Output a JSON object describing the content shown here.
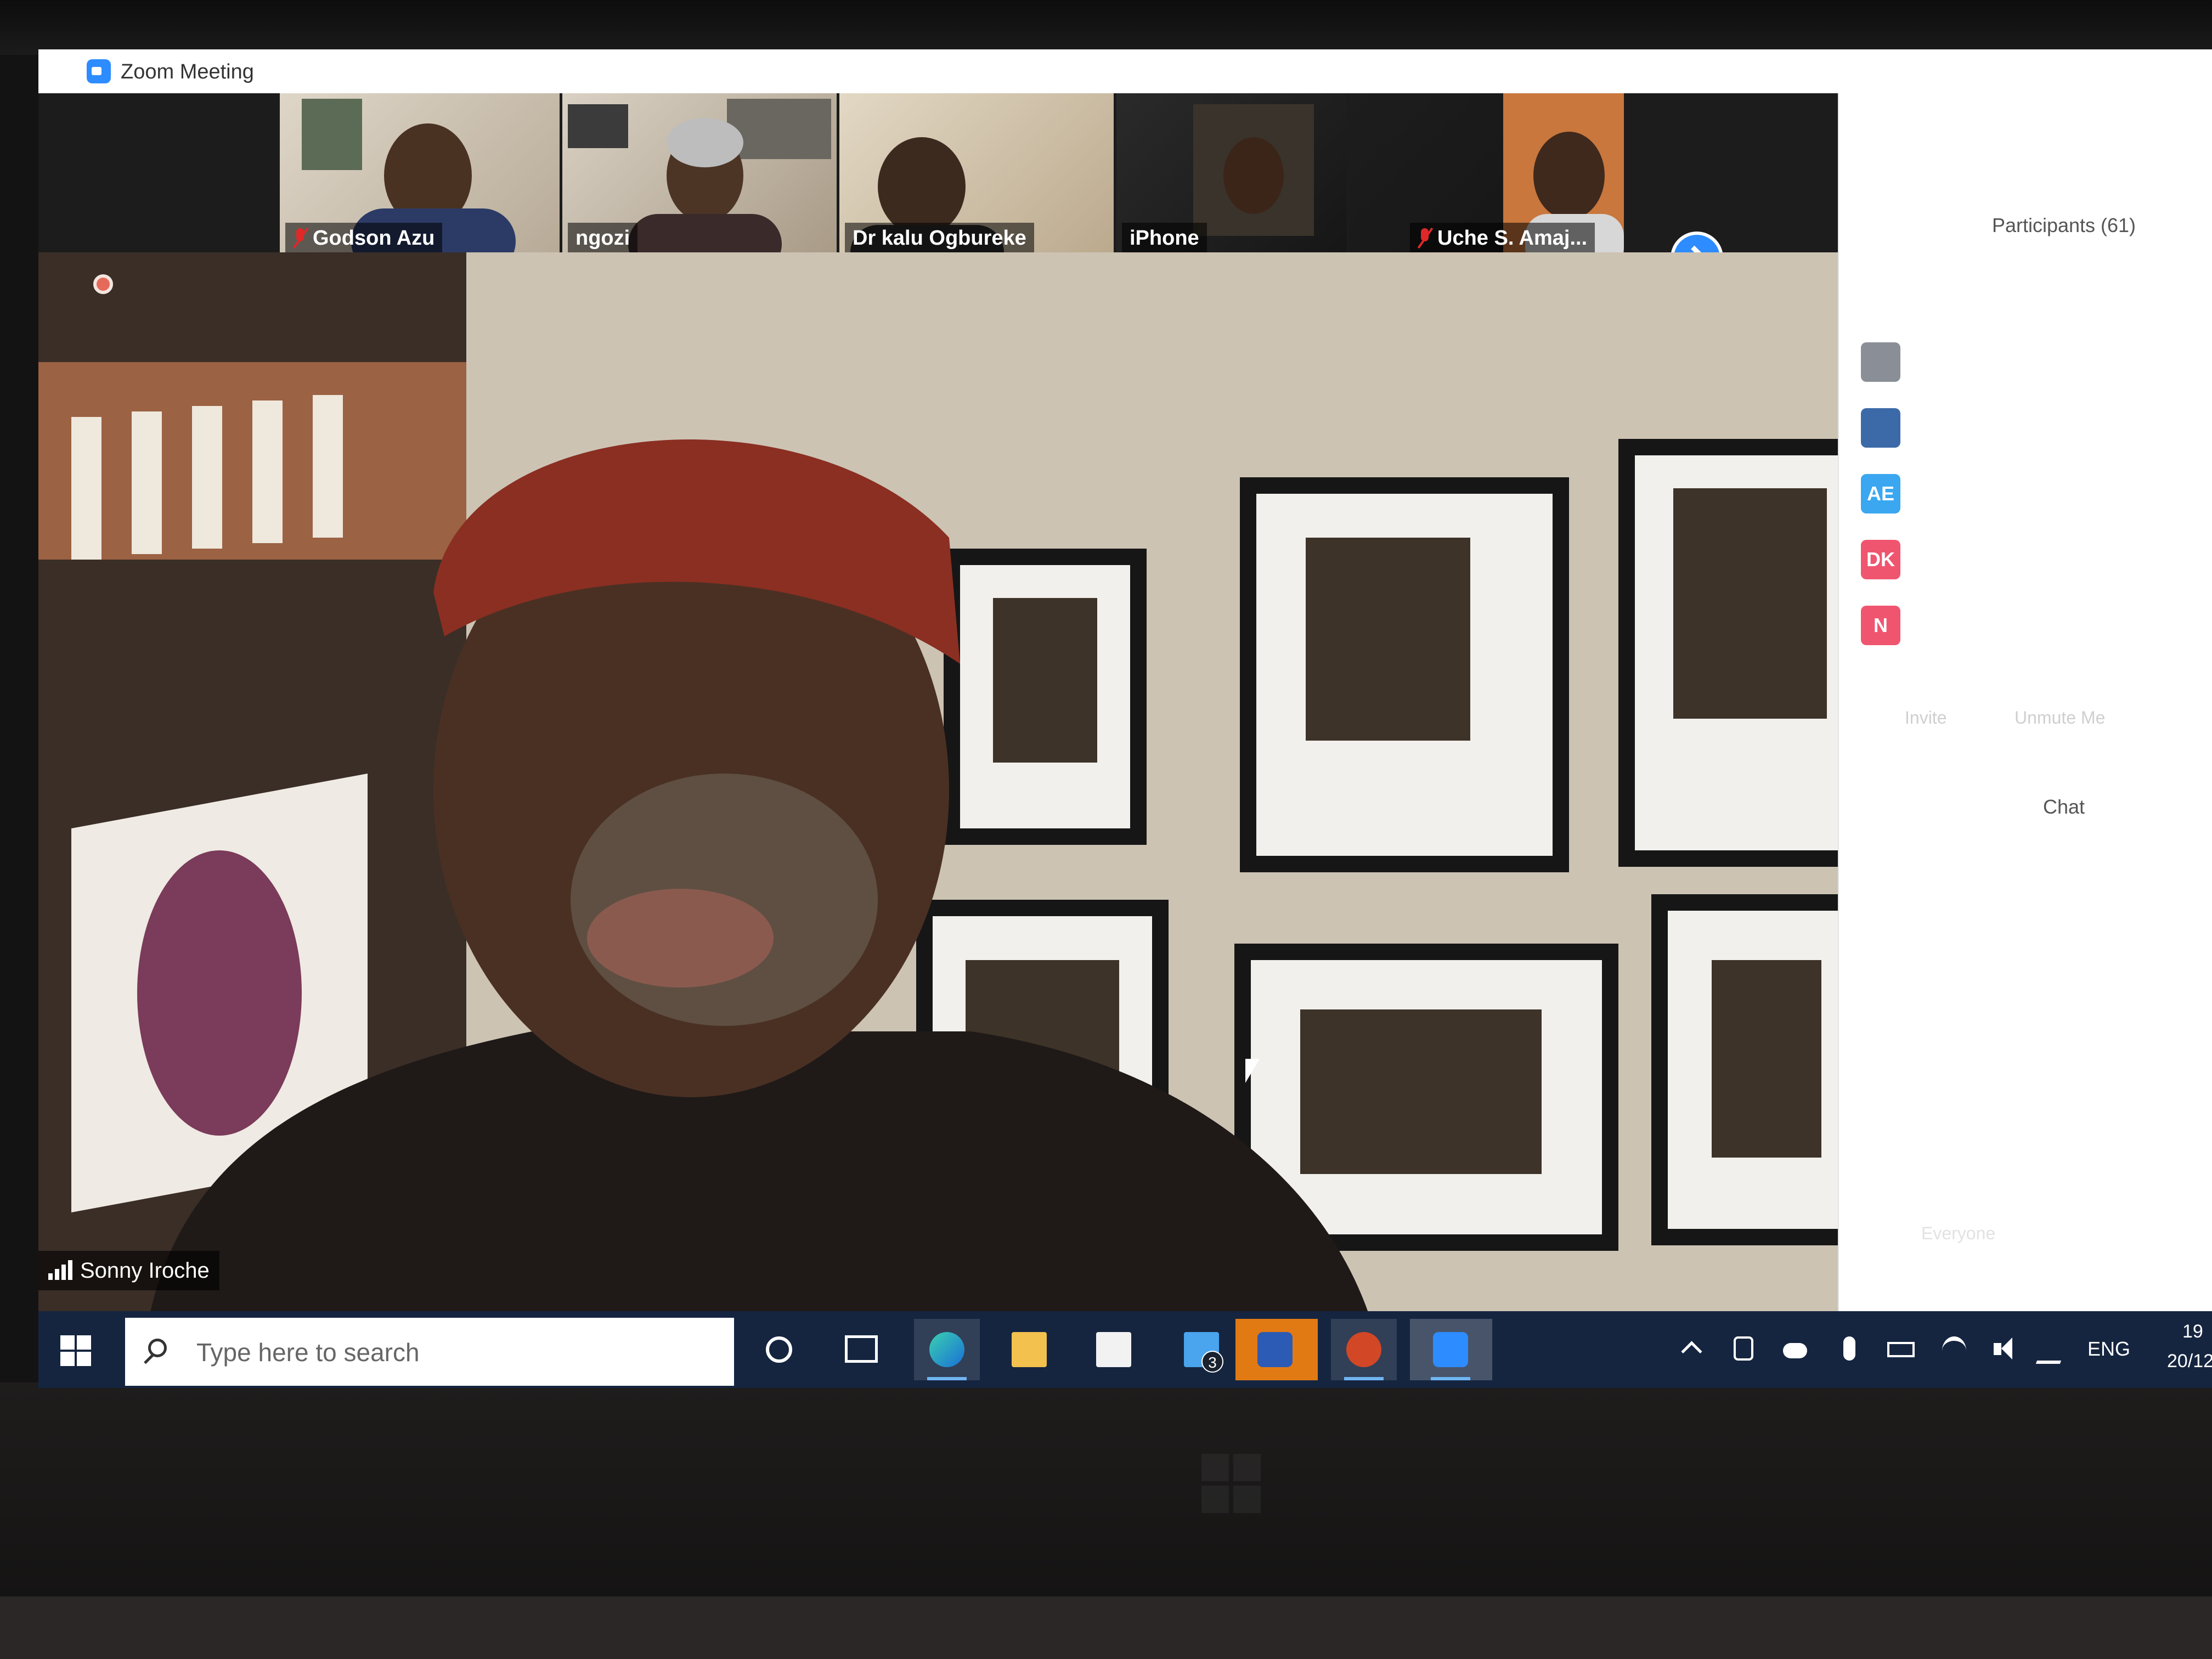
{
  "window": {
    "title": "Zoom Meeting"
  },
  "gallery": {
    "thumbnails": [
      {
        "name": "Godson Azu",
        "muted": true
      },
      {
        "name": "ngozi",
        "muted": false
      },
      {
        "name": "Dr kalu Ogbureke",
        "muted": false
      },
      {
        "name": "iPhone",
        "muted": false
      },
      {
        "name": "Uche S. Amaj...",
        "muted": true
      }
    ]
  },
  "main_video": {
    "speaker_name": "Sonny Iroche"
  },
  "participants_panel": {
    "title": "Participants (61)",
    "entries": [
      {
        "initials": "",
        "color": "#8a8f97"
      },
      {
        "initials": "",
        "color": "#3c6aa8"
      },
      {
        "initials": "AE",
        "color": "#3aa7f0"
      },
      {
        "initials": "DK",
        "color": "#f0556f"
      },
      {
        "initials": "N",
        "color": "#f0556f"
      }
    ],
    "invite_label": "Invite",
    "unmute_label": "Unmute Me"
  },
  "chat_panel": {
    "title": "Chat",
    "to_label": "Everyone"
  },
  "taskbar": {
    "search_placeholder": "Type here to search",
    "mail_badge": "3",
    "language": "ENG",
    "clock_time": "19",
    "clock_date": "20/12"
  },
  "colors": {
    "zoom_blue": "#2d8cff",
    "taskbar_bg": "#152540",
    "highlight_orange": "#e27a14"
  }
}
